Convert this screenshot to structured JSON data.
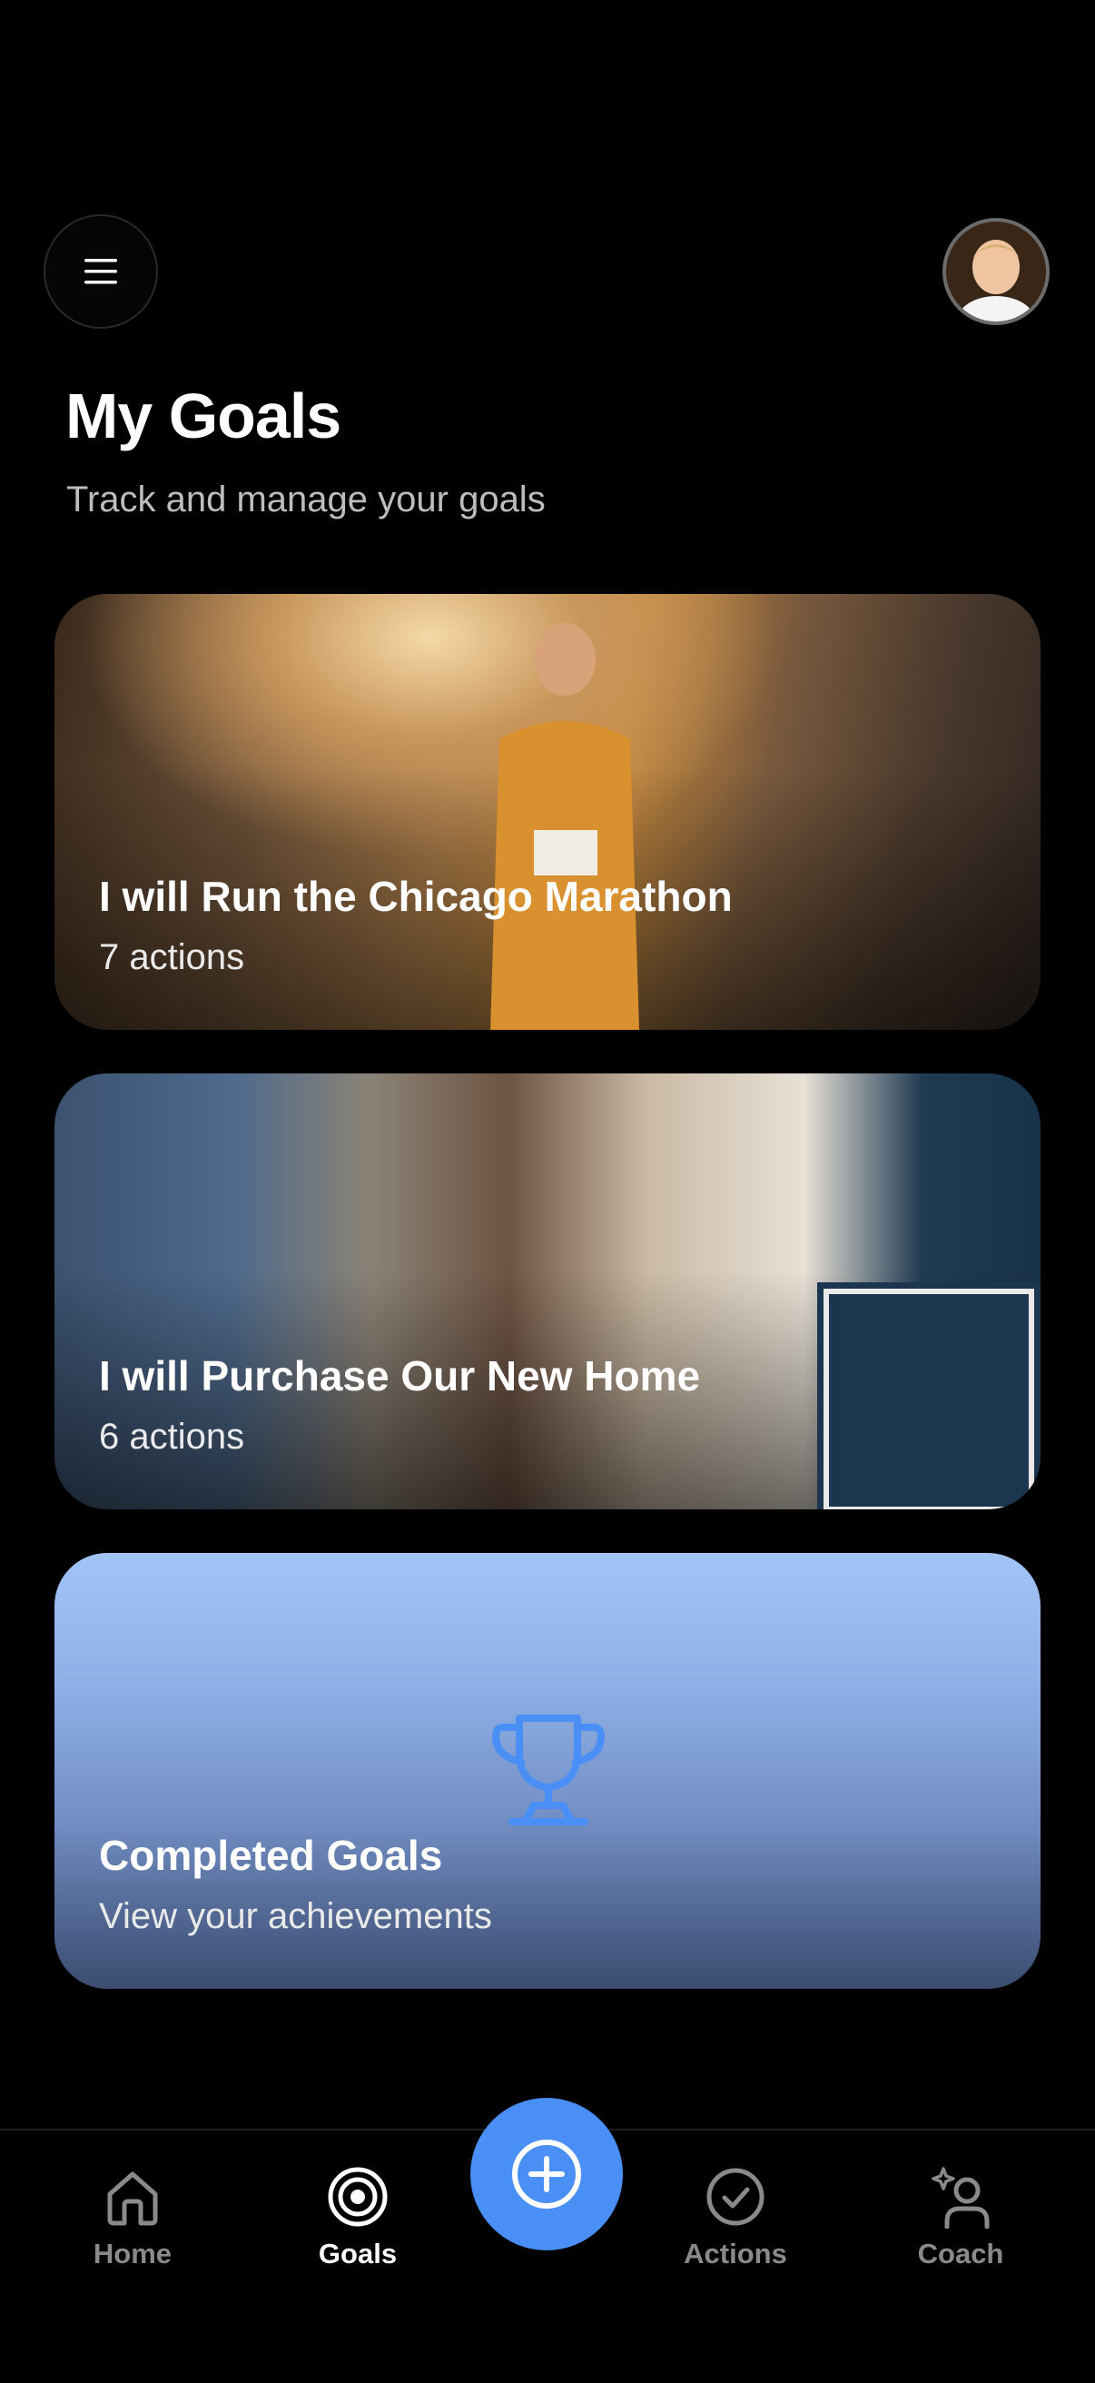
{
  "header": {
    "title": "My Goals",
    "subtitle": "Track and manage your goals"
  },
  "goals": [
    {
      "title": "I will Run the Chicago Marathon",
      "actions": "7 actions"
    },
    {
      "title": "I will Purchase Our New Home",
      "actions": "6 actions"
    }
  ],
  "completed": {
    "title": "Completed Goals",
    "subtitle": "View your achievements"
  },
  "tabs": [
    {
      "label": "Home",
      "icon": "home-icon"
    },
    {
      "label": "Goals",
      "icon": "target-icon",
      "active": true
    },
    {
      "label": "Actions",
      "icon": "check-circle-icon"
    },
    {
      "label": "Coach",
      "icon": "coach-sparkle-icon"
    }
  ],
  "fab": {
    "icon": "plus-circle-icon"
  },
  "colors": {
    "background": "#000000",
    "accent": "#4a8ff5",
    "tab_inactive": "#8a8a8a",
    "tab_active": "#ffffff"
  }
}
